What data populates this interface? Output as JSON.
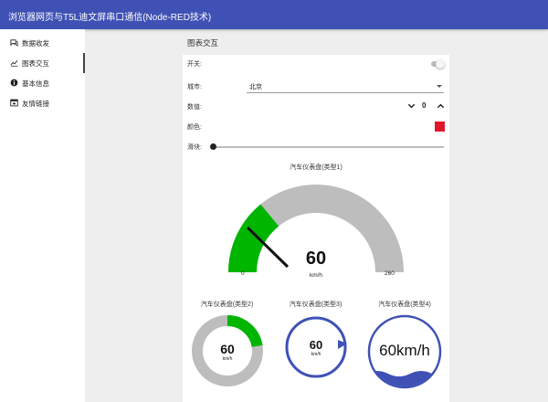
{
  "header": {
    "title": "浏览器网页与T5L迪文屏串口通信(Node-RED技术)"
  },
  "sidebar": {
    "items": [
      {
        "label": "数据收发",
        "icon": "chat-icon"
      },
      {
        "label": "图表交互",
        "icon": "line-chart-icon",
        "active": true
      },
      {
        "label": "基本信息",
        "icon": "info-icon"
      },
      {
        "label": "友情链接",
        "icon": "link-window-icon"
      }
    ]
  },
  "main": {
    "title": "图表交互",
    "form": {
      "switch_label": "开关:",
      "switch_on": false,
      "city_label": "城市:",
      "city_value": "北京",
      "number_label": "数值:",
      "number_value": "0",
      "color_label": "颜色:",
      "color_value": "#e0172b",
      "slider_label": "滑块:",
      "slider_value": 0
    },
    "gauges": {
      "main": {
        "title": "汽车仪表盘(类型1)",
        "value": "60",
        "unit": "km/h",
        "min": "0",
        "max": "260"
      },
      "g2": {
        "title": "汽车仪表盘(类型2)",
        "value": "60",
        "unit": "km/h"
      },
      "g3": {
        "title": "汽车仪表盘(类型3)",
        "value": "60",
        "unit": "km/h"
      },
      "g4": {
        "title": "汽车仪表盘(类型4)",
        "value": "60km/h"
      }
    }
  },
  "colors": {
    "header": "#3f51b5",
    "gauge_fill": "#00b500",
    "gauge_track": "#bdbdbd",
    "ring_blue": "#3f51b5"
  }
}
